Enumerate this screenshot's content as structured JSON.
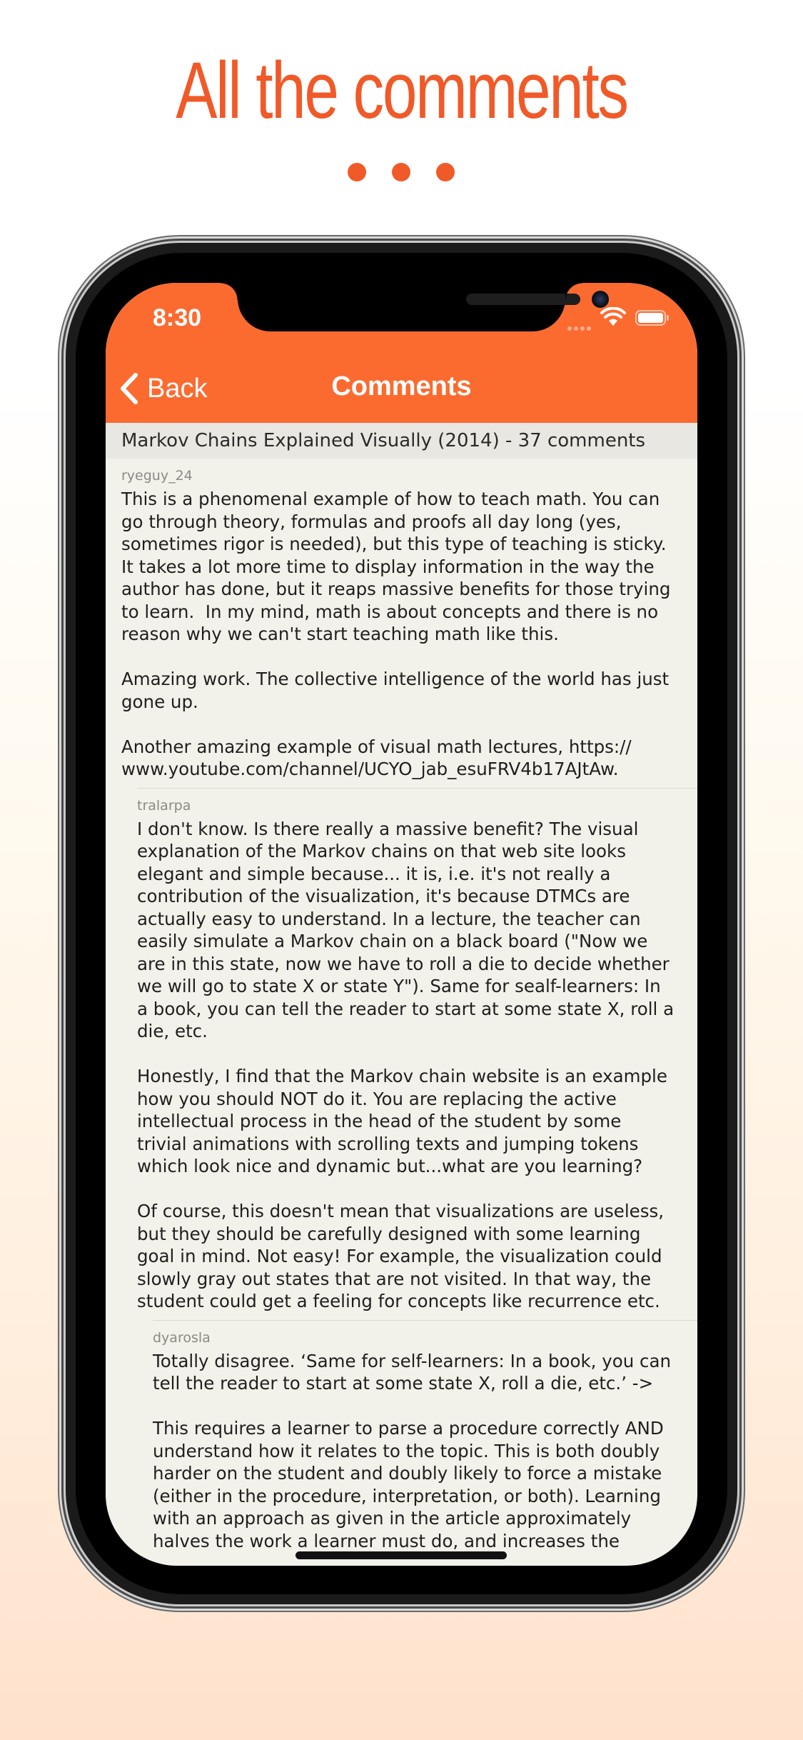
{
  "headline": "All the comments",
  "status_bar": {
    "time": "8:30"
  },
  "nav": {
    "back_label": "Back",
    "title": "Comments"
  },
  "story_header": "Markov Chains Explained Visually (2014) - 37 comments",
  "comments": [
    {
      "author": "ryeguy_24",
      "depth": 0,
      "lines": [
        "This is a phenomenal example of how to teach math. You can",
        "go through theory, formulas and proofs all day long (yes,",
        "sometimes rigor is needed), but this type of teaching is sticky.",
        "It takes a lot more time to display information in the way the",
        "author has done, but it reaps massive benefits for those trying",
        "to learn.  In my mind, math is about concepts and there is no",
        "reason why we can't start teaching math like this.",
        "",
        "Amazing work. The collective intelligence of the world has just",
        "gone up.",
        "",
        "Another amazing example of visual math lectures, https://",
        "www.youtube.com/channel/UCYO_jab_esuFRV4b17AJtAw."
      ]
    },
    {
      "author": "tralarpa",
      "depth": 1,
      "lines": [
        "I don't know. Is there really a massive benefit? The visual",
        "explanation of the Markov chains on that web site looks",
        "elegant and simple because... it is, i.e. it's not really a",
        "contribution of the visualization, it's because DTMCs are",
        "actually easy to understand. In a lecture, the teacher can",
        "easily simulate a Markov chain on a black board (\"Now we",
        "are in this state, now we have to roll a die to decide whether",
        "we will go to state X or state Y\"). Same for sealf-learners: In",
        "a book, you can tell the reader to start at some state X, roll a",
        "die, etc.",
        "",
        "Honestly, I find that the Markov chain website is an example",
        "how you should NOT do it. You are replacing the active",
        "intellectual process in the head of the student by some",
        "trivial animations with scrolling texts and jumping tokens",
        "which look nice and dynamic but...what are you learning?",
        "",
        "Of course, this doesn't mean that visualizations are useless,",
        "but they should be carefully designed with some learning",
        "goal in mind. Not easy! For example, the visualization could",
        "slowly gray out states that are not visited. In that way, the",
        "student could get a feeling for concepts like recurrence etc."
      ]
    },
    {
      "author": "dyarosla",
      "depth": 2,
      "lines": [
        "Totally disagree. ‘Same for self-learners: In a book, you can",
        "tell the reader to start at some state X, roll a die, etc.’ ->",
        "",
        "This requires a learner to parse a procedure correctly AND",
        "understand how it relates to the topic. This is both doubly",
        "harder on the student and doubly likely to force a mistake",
        "(either in the procedure, interpretation, or both). Learning",
        "with an approach as given in the article approximately",
        "halves the work a learner must do, and increases the"
      ]
    }
  ]
}
